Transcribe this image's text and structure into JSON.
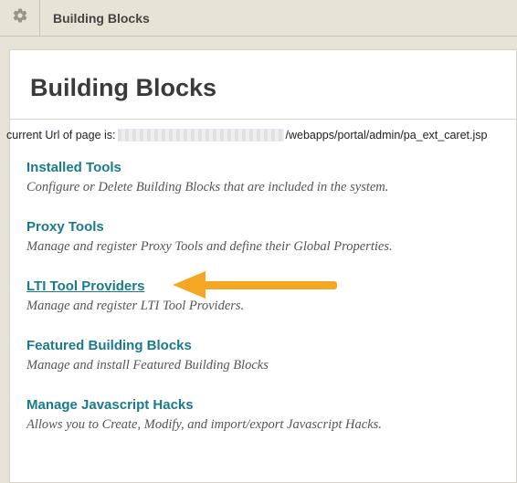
{
  "topbar": {
    "breadcrumb": "Building Blocks"
  },
  "page": {
    "title": "Building Blocks"
  },
  "url_line": {
    "prefix": "current Url of page is: ",
    "suffix": "/webapps/portal/admin/pa_ext_caret.jsp"
  },
  "items": [
    {
      "title": "Installed Tools",
      "desc": "Configure or Delete Building Blocks that are included in the system."
    },
    {
      "title": "Proxy Tools",
      "desc": "Manage and register Proxy Tools and define their Global Properties."
    },
    {
      "title": "LTI Tool Providers",
      "desc": "Manage and register LTI Tool Providers."
    },
    {
      "title": "Featured Building Blocks",
      "desc": "Manage and install Featured Building Blocks"
    },
    {
      "title": "Manage Javascript Hacks",
      "desc": "Allows you to Create, Modify, and import/export Javascript Hacks."
    }
  ],
  "annotation": {
    "arrow_color": "#F5A623"
  }
}
